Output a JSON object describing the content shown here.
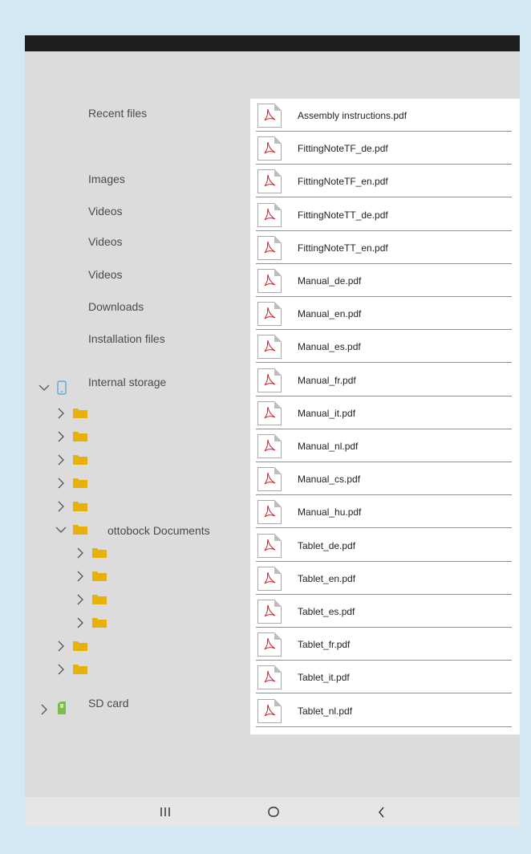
{
  "sidebar": {
    "nav_items": [
      "Recent files",
      "Images",
      "Videos",
      "Videos",
      "Videos",
      "Downloads",
      "Installation files"
    ],
    "internal_storage": "Internal storage",
    "documents_folder": "ottobock Documents",
    "sd_card": "SD card"
  },
  "files": [
    "Assembly instructions.pdf",
    "FittingNoteTF_de.pdf",
    "FittingNoteTF_en.pdf",
    "FittingNoteTT_de.pdf",
    "FittingNoteTT_en.pdf",
    "Manual_de.pdf",
    "Manual_en.pdf",
    "Manual_es.pdf",
    "Manual_fr.pdf",
    "Manual_it.pdf",
    "Manual_nl.pdf",
    "Manual_cs.pdf",
    "Manual_hu.pdf",
    "Tablet_de.pdf",
    "Tablet_en.pdf",
    "Tablet_es.pdf",
    "Tablet_fr.pdf",
    "Tablet_it.pdf",
    "Tablet_nl.pdf"
  ],
  "colors": {
    "page_background": "#d3e8f2",
    "folder": "#e7b10a",
    "pdf_accent": "#d0202a",
    "phone_icon": "#5aa9d6",
    "sd_icon": "#7bbf4a"
  },
  "icons": {
    "file": "pdf-file-icon",
    "folder": "folder-icon",
    "storage": "phone-storage-icon",
    "sd": "sd-card-icon",
    "nav": [
      "recent-apps-icon",
      "home-icon",
      "back-icon"
    ]
  }
}
